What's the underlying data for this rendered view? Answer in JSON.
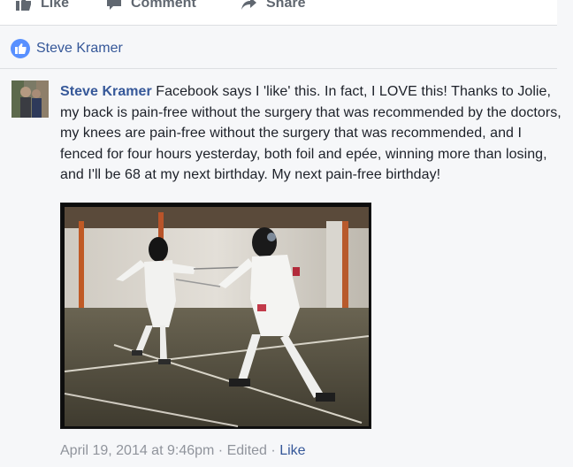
{
  "actions": {
    "like_label": "Like",
    "comment_label": "Comment",
    "share_label": "Share"
  },
  "reactions": {
    "likers": "Steve Kramer"
  },
  "comment": {
    "author": "Steve Kramer",
    "text": "Facebook says I 'like' this. In fact, I LOVE this! Thanks to Jolie, my back is pain-free without the surgery that was recommended by the doctors, my knees are pain-free without the surgery that was recommended, and I fenced for four hours yesterday, both foil and epée, winning more than losing, and I'll be 68 at my next birthday. My next pain-free birthday!",
    "timestamp": "April 19, 2014 at 9:46pm",
    "separator": "·",
    "edited_label": "Edited",
    "like_label": "Like"
  },
  "colors": {
    "link_blue": "#365899",
    "like_blue": "#5890ff",
    "meta_gray": "#90949c",
    "background": "#f6f7f9"
  },
  "icons": [
    "like-thumb-icon",
    "comment-bubble-icon",
    "share-arrow-icon",
    "like-reaction-icon"
  ]
}
